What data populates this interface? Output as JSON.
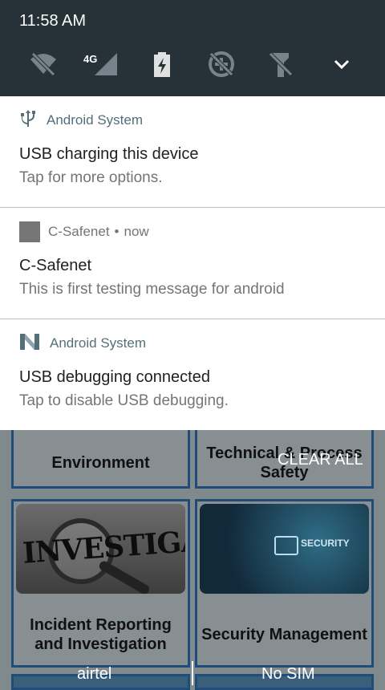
{
  "status": {
    "time": "11:58 AM",
    "network_label": "4G"
  },
  "quick_settings": [
    {
      "icon": "wifi-off-icon"
    },
    {
      "icon": "signal-4g-icon"
    },
    {
      "icon": "battery-charging-icon"
    },
    {
      "icon": "data-saver-off-icon"
    },
    {
      "icon": "flashlight-off-icon"
    },
    {
      "icon": "expand-chevron-icon"
    }
  ],
  "notifications": [
    {
      "app": "Android System",
      "icon": "usb-icon",
      "time": "",
      "title": "USB charging this device",
      "text": "Tap for more options."
    },
    {
      "app": "C-Safenet",
      "icon": "app-square-icon",
      "time": "now",
      "title": "C-Safenet",
      "text": "This is first testing message for android"
    },
    {
      "app": "Android System",
      "icon": "android-n-icon",
      "time": "",
      "title": "USB debugging connected",
      "text": "Tap to disable USB debugging."
    }
  ],
  "clear_all": "CLEAR ALL",
  "background_app": {
    "tiles": [
      {
        "label": "Environment"
      },
      {
        "label": "Technical & Process Safety"
      },
      {
        "label": "Incident Reporting and Investigation",
        "image_text": "INVESTIGATION"
      },
      {
        "label": "Security Management",
        "image_text": "SECURITY"
      }
    ]
  },
  "carriers": {
    "sim1": "airtel",
    "sim2": "No SIM"
  },
  "colors": {
    "shade": "#263238",
    "accent": "#546e7a",
    "tile_border": "#1f4c7a"
  }
}
